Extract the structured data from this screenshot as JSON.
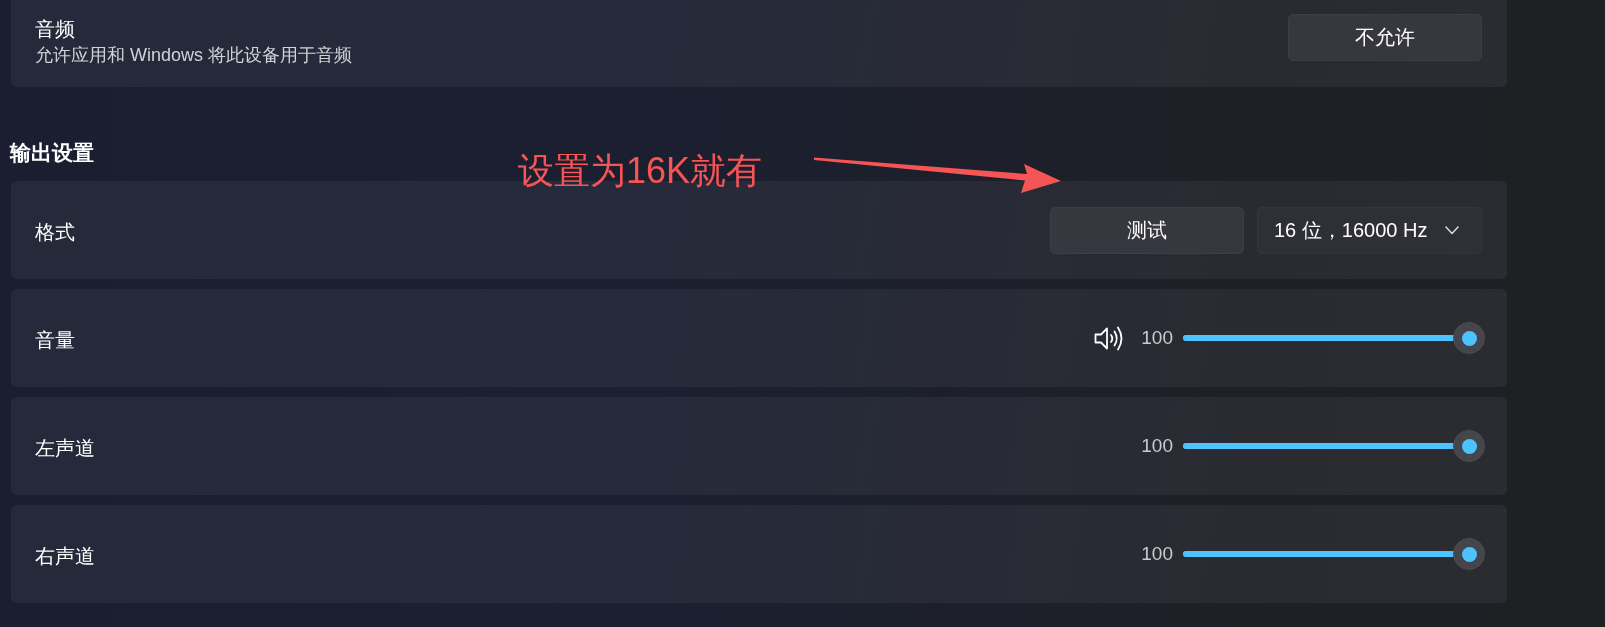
{
  "audio_card": {
    "title": "音频",
    "description": "允许应用和 Windows 将此设备用于音频",
    "button": "不允许"
  },
  "output_settings": {
    "heading": "输出设置",
    "rows": [
      {
        "kind": "format",
        "label": "格式",
        "button": "测试",
        "dropdown": "16 位，16000 Hz"
      },
      {
        "kind": "volume",
        "label": "音量",
        "reading": "100",
        "level": 1
      },
      {
        "kind": "channel",
        "label": "左声道",
        "reading": "100",
        "level": 1
      },
      {
        "kind": "channel",
        "label": "右声道",
        "reading": "100",
        "level": 1
      }
    ]
  },
  "annotation": {
    "text": "设置为16K就有"
  }
}
